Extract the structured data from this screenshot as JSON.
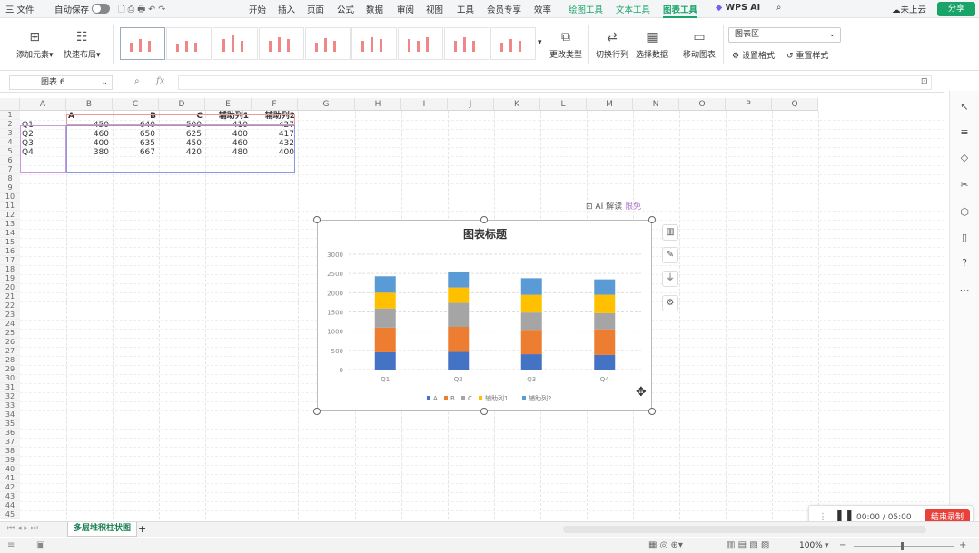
{
  "menubar": {
    "items": [
      "三 文件",
      "自动保存",
      "开始",
      "插入",
      "页面",
      "公式",
      "数据",
      "审阅",
      "视图",
      "工具",
      "会员专享",
      "效率",
      "绘图工具",
      "文本工具",
      "图表工具",
      "WPS AI"
    ],
    "cloud": "未上云",
    "share": "分享"
  },
  "ribbon": {
    "add_element": "添加元素",
    "quick_layout": "快速布局",
    "change_type": "更改类型",
    "switch_row_col": "切换行列",
    "select_data": "选择数据",
    "move_chart": "移动图表",
    "area_dropdown": "图表区",
    "set_format": "设置格式",
    "reset_style": "重置样式"
  },
  "formula_bar": {
    "name_box": "图表 6",
    "fx": "fx"
  },
  "grid": {
    "columns": [
      "A",
      "B",
      "C",
      "D",
      "E",
      "F",
      "G",
      "H",
      "I",
      "J",
      "K",
      "L",
      "M",
      "N",
      "O",
      "P",
      "Q"
    ],
    "rows": [
      "1",
      "2",
      "3",
      "4",
      "5",
      "6",
      "7",
      "8",
      "9",
      "10",
      "11",
      "12",
      "13",
      "14",
      "15",
      "16",
      "17",
      "18",
      "19",
      "20",
      "21",
      "22",
      "23",
      "24",
      "25",
      "26",
      "27",
      "28",
      "29",
      "30",
      "31",
      "32",
      "33",
      "34",
      "35",
      "36",
      "37",
      "38",
      "39",
      "40",
      "41",
      "42",
      "43",
      "44",
      "45"
    ],
    "header_row": [
      "A",
      "B",
      "C",
      "辅助列1",
      "辅助列2"
    ],
    "table": [
      {
        "label": "Q1",
        "values": [
          450,
          640,
          500,
          410,
          427
        ]
      },
      {
        "label": "Q2",
        "values": [
          460,
          650,
          625,
          400,
          417
        ]
      },
      {
        "label": "Q3",
        "values": [
          400,
          635,
          450,
          460,
          432
        ]
      },
      {
        "label": "Q4",
        "values": [
          380,
          667,
          420,
          480,
          400
        ]
      }
    ]
  },
  "ai_tag": {
    "label": "AI 解读",
    "badge": "限免"
  },
  "chart_data": {
    "type": "bar",
    "stacked": true,
    "title": "图表标题",
    "categories": [
      "Q1",
      "Q2",
      "Q3",
      "Q4"
    ],
    "series": [
      {
        "name": "A",
        "values": [
          450,
          460,
          400,
          380
        ],
        "color": "#4472c4"
      },
      {
        "name": "B",
        "values": [
          640,
          650,
          635,
          667
        ],
        "color": "#ed7d31"
      },
      {
        "name": "C",
        "values": [
          500,
          625,
          450,
          420
        ],
        "color": "#a5a5a5"
      },
      {
        "name": "辅助列1",
        "values": [
          410,
          400,
          460,
          480
        ],
        "color": "#ffc000"
      },
      {
        "name": "辅助列2",
        "values": [
          427,
          417,
          432,
          400
        ],
        "color": "#5b9bd5"
      }
    ],
    "ylim": [
      0,
      3000
    ],
    "yticks": [
      "0",
      "500",
      "1000",
      "1500",
      "2000",
      "2500",
      "3000"
    ],
    "grid": true,
    "legend": "bottom"
  },
  "sheet_tabs": {
    "active": "多层堆积柱状图",
    "add": "+"
  },
  "status": {
    "zoom": "100%"
  },
  "recorder": {
    "time": "00:00 / 05:00",
    "stop": "结束录制"
  }
}
